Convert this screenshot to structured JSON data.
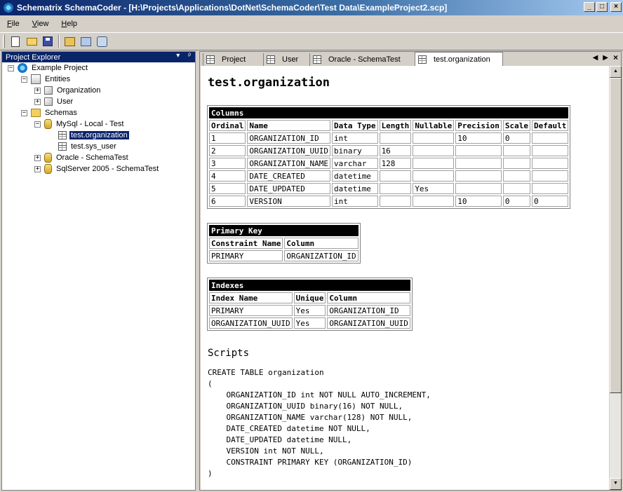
{
  "window": {
    "title": "Schematrix SchemaCoder - [H:\\Projects\\Applications\\DotNet\\SchemaCoder\\Test Data\\ExampleProject2.scp]",
    "controls": [
      "_",
      "□",
      "×"
    ]
  },
  "menu": {
    "items": [
      "File",
      "View",
      "Help"
    ]
  },
  "toolbar": {
    "buttons": [
      "new-file-icon",
      "open-folder-icon",
      "save-icon",
      "generate-icon",
      "connect-icon",
      "settings-icon"
    ]
  },
  "explorer": {
    "title": "Project Explorer",
    "pin": "▾",
    "dock": "ᵖ",
    "tree": {
      "project": "Example Project",
      "entities": "Entities",
      "entity_organization": "Organization",
      "entity_user": "User",
      "schemas": "Schemas",
      "mysql": "MySql - Local - Test",
      "table_org": "test.organization",
      "table_sysuser": "test.sys_user",
      "oracle": "Oracle - SchemaTest",
      "sqlserver": "SqlServer 2005 - SchemaTest"
    },
    "expanders": {
      "minus": "−",
      "plus": "+"
    }
  },
  "tabs": [
    "Project",
    "User",
    "Oracle - SchemaTest",
    "test.organization"
  ],
  "tab_controls": {
    "prev": "◀",
    "next": "▶",
    "close": "×"
  },
  "document": {
    "title": "test.organization",
    "columns_table": {
      "caption": "Columns",
      "headers": [
        "Ordinal",
        "Name",
        "Data Type",
        "Length",
        "Nullable",
        "Precision",
        "Scale",
        "Default"
      ],
      "rows": [
        [
          "1",
          "ORGANIZATION_ID",
          "int",
          "",
          "",
          "10",
          "0",
          ""
        ],
        [
          "2",
          "ORGANIZATION_UUID",
          "binary",
          "16",
          "",
          "",
          "",
          ""
        ],
        [
          "3",
          "ORGANIZATION_NAME",
          "varchar",
          "128",
          "",
          "",
          "",
          ""
        ],
        [
          "4",
          "DATE_CREATED",
          "datetime",
          "",
          "",
          "",
          "",
          ""
        ],
        [
          "5",
          "DATE_UPDATED",
          "datetime",
          "",
          "Yes",
          "",
          "",
          ""
        ],
        [
          "6",
          "VERSION",
          "int",
          "",
          "",
          "10",
          "0",
          "0"
        ]
      ]
    },
    "primary_key_table": {
      "caption": "Primary Key",
      "headers": [
        "Constraint Name",
        "Column"
      ],
      "rows": [
        [
          "PRIMARY",
          "ORGANIZATION_ID"
        ]
      ]
    },
    "indexes_table": {
      "caption": "Indexes",
      "headers": [
        "Index Name",
        "Unique",
        "Column"
      ],
      "rows": [
        [
          "PRIMARY",
          "Yes",
          "ORGANIZATION_ID"
        ],
        [
          "ORGANIZATION_UUID",
          "Yes",
          "ORGANIZATION_UUID"
        ]
      ]
    },
    "scripts_heading": "Scripts",
    "script": "CREATE TABLE organization\n(\n    ORGANIZATION_ID int NOT NULL AUTO_INCREMENT,\n    ORGANIZATION_UUID binary(16) NOT NULL,\n    ORGANIZATION_NAME varchar(128) NOT NULL,\n    DATE_CREATED datetime NOT NULL,\n    DATE_UPDATED datetime NULL,\n    VERSION int NOT NULL,\n    CONSTRAINT PRIMARY KEY (ORGANIZATION_ID)\n)\n\nCREATE UNIQUE INDEX PRIMARY"
  },
  "scrollbar": {
    "up": "▲",
    "down": "▼"
  },
  "colors": {
    "titlebar": "#0a246a",
    "selection": "#0a246a",
    "chrome": "#d4d0c8",
    "table_caption": "#000000"
  }
}
